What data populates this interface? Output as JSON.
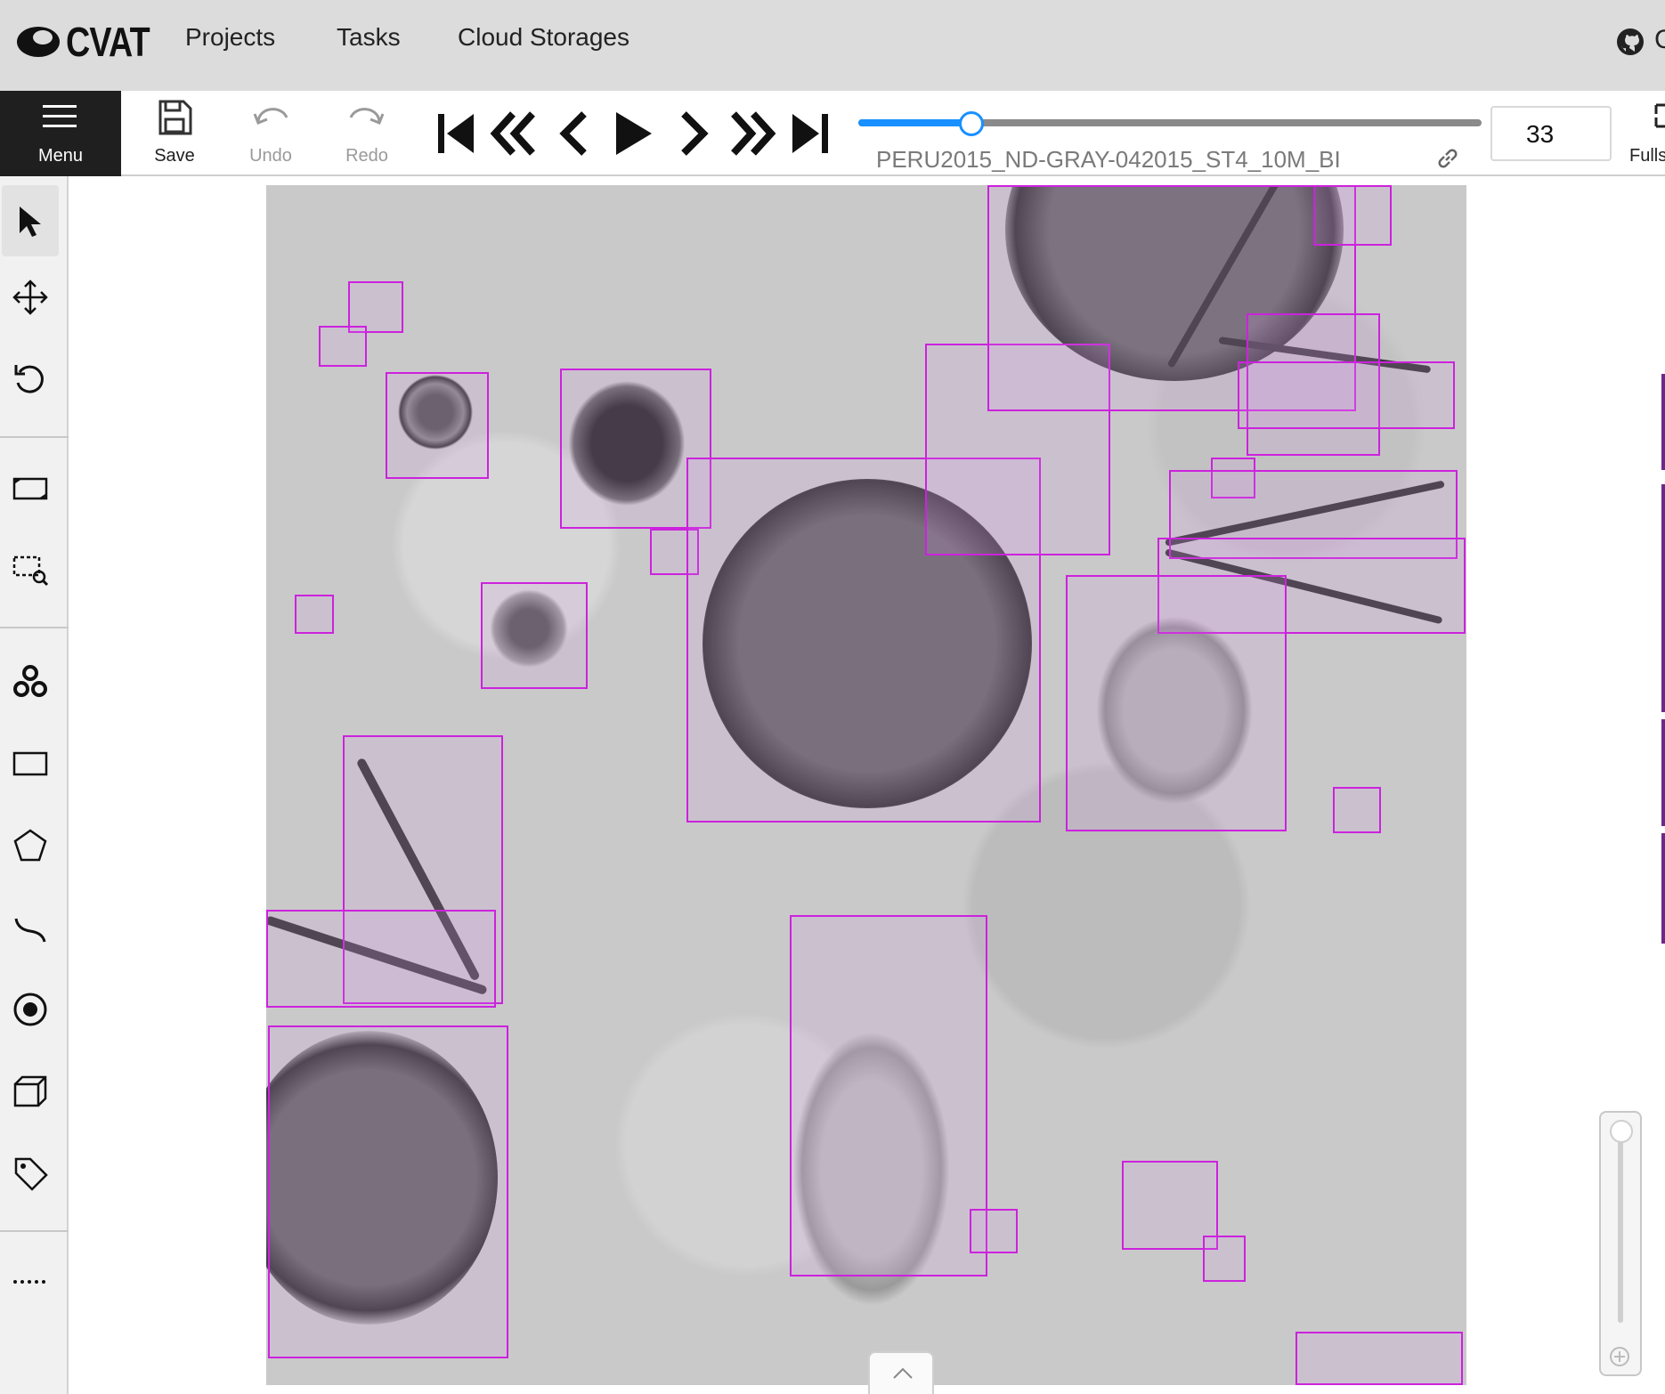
{
  "header": {
    "logo_text": "CVAT",
    "nav": [
      "Projects",
      "Tasks",
      "Cloud Storages"
    ],
    "github_icon": "github-icon"
  },
  "toolbar": {
    "menu_label": "Menu",
    "save_label": "Save",
    "undo_label": "Undo",
    "redo_label": "Redo",
    "playback_icons": [
      "first-frame-icon",
      "back-step-icon",
      "previous-icon",
      "play-icon",
      "next-icon",
      "forward-step-icon",
      "last-frame-icon"
    ],
    "frame_slider_fraction": 0.18,
    "filename": "PERU2015_ND-GRAY-042015_ST4_10M_BI",
    "frame_number": "33",
    "fullscreen_label": "Fullscreen"
  },
  "sidebar": {
    "tools": [
      "cursor-icon",
      "move-icon",
      "rotate-icon",
      "fit-image-icon",
      "zoom-region-icon",
      "ai-tools-icon",
      "rectangle-icon",
      "polygon-icon",
      "polyline-icon",
      "points-icon",
      "cuboid-icon",
      "tag-icon",
      "more-icon"
    ]
  },
  "canvas": {
    "annotation_color": "#cc22dd",
    "zoom_icon": "zoom-in-icon",
    "collapse_icon": "chevron-up-icon"
  }
}
